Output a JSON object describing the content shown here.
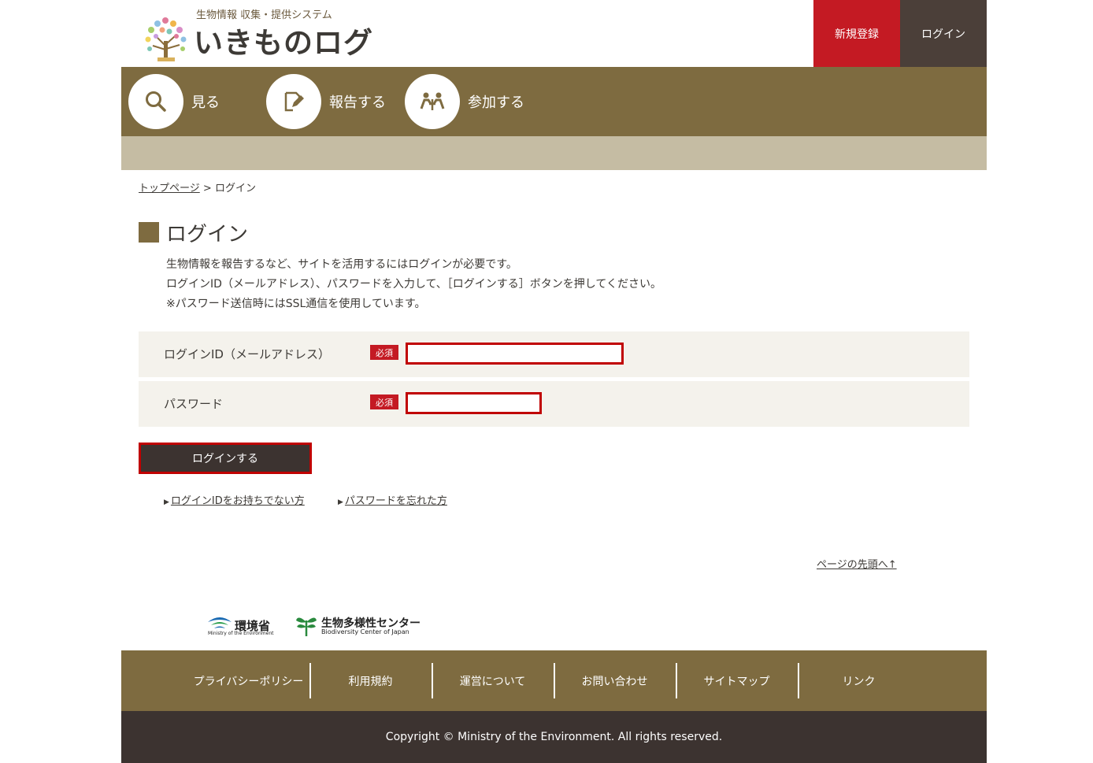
{
  "header": {
    "logo_sub": "生物情報 収集・提供システム",
    "logo_main": "いきものログ",
    "register_label": "新規登録",
    "login_label": "ログイン"
  },
  "nav": {
    "items": [
      {
        "label": "見る",
        "icon": "search-icon"
      },
      {
        "label": "報告する",
        "icon": "edit-icon"
      },
      {
        "label": "参加する",
        "icon": "people-icon"
      }
    ]
  },
  "breadcrumb": {
    "home": "トップページ",
    "separator": ">",
    "current": "ログイン"
  },
  "main": {
    "title": "ログイン",
    "intro": [
      "生物情報を報告するなど、サイトを活用するにはログインが必要です。",
      "ログインID（メールアドレス）、パスワードを入力して、［ログインする］ボタンを押してください。",
      "※パスワード送信時にはSSL通信を使用しています。"
    ],
    "form": {
      "login_id_label": "ログインID（メールアドレス）",
      "password_label": "パスワード",
      "required_badge": "必須",
      "login_id_value": "",
      "password_value": ""
    },
    "submit_label": "ログインする",
    "help_links": {
      "no_id": "ログインIDをお持ちでない方",
      "forgot_password": "パスワードを忘れた方"
    },
    "page_top": "ページの先頭へ↑"
  },
  "logos": {
    "moe_name": "環境省",
    "moe_en": "Ministry of the Environment",
    "bcj_name": "生物多様性センター",
    "bcj_en": "Biodiversity Center of Japan"
  },
  "footer": {
    "links": [
      "プライバシーポリシー",
      "利用規約",
      "運営について",
      "お問い合わせ",
      "サイトマップ",
      "リンク"
    ],
    "copyright": "Copyright © Ministry of the Environment. All rights reserved."
  },
  "colors": {
    "brand_brown": "#7e6b40",
    "light_band": "#c5bca3",
    "accent_red": "#c41a23",
    "dark": "#3c3330"
  }
}
